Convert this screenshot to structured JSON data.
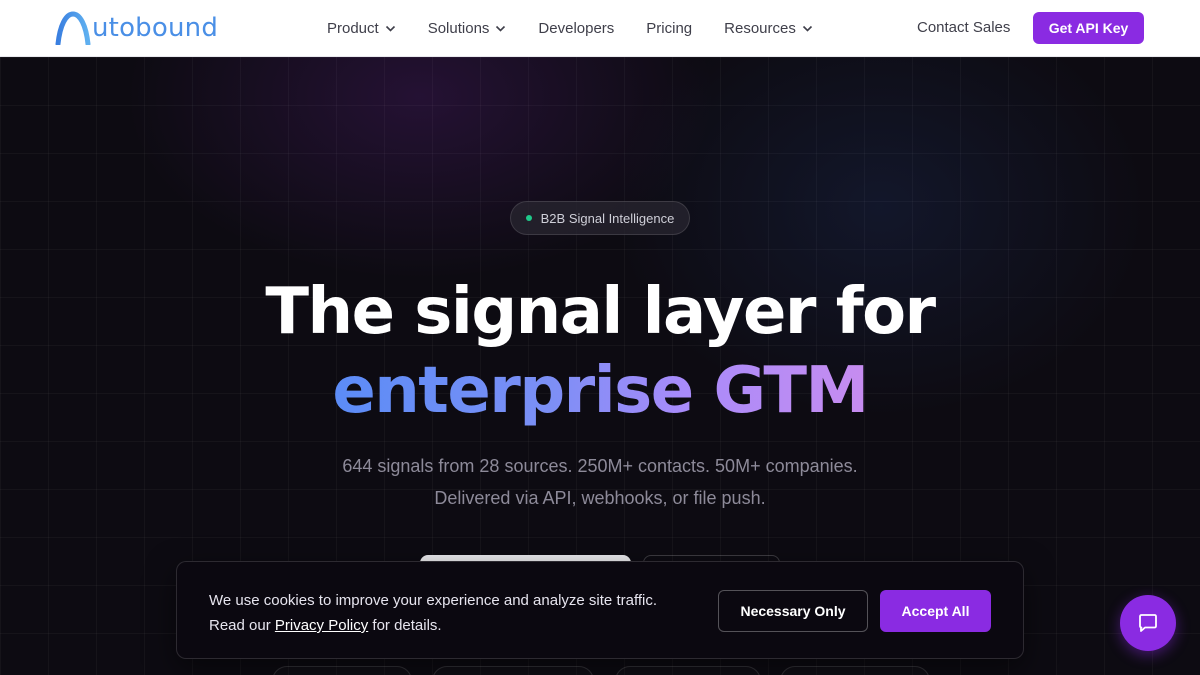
{
  "nav": {
    "logo_text": "utobound",
    "items": [
      {
        "label": "Product",
        "has_dropdown": true
      },
      {
        "label": "Solutions",
        "has_dropdown": true
      },
      {
        "label": "Developers",
        "has_dropdown": false
      },
      {
        "label": "Pricing",
        "has_dropdown": false
      },
      {
        "label": "Resources",
        "has_dropdown": true
      }
    ],
    "contact_label": "Contact Sales",
    "cta_label": "Get API Key"
  },
  "hero": {
    "badge": "B2B Signal Intelligence",
    "headline_line1": "The signal layer for",
    "headline_line2": "enterprise GTM",
    "subtitle_line1": "644 signals from 28 sources. 250M+ contacts. 50M+ companies.",
    "subtitle_line2": "Delivered via API, webhooks, or file push."
  },
  "cookie": {
    "line1": "We use cookies to improve your experience and analyze site traffic.",
    "line2_prefix": "Read our ",
    "link_label": "Privacy Policy",
    "line2_suffix": " for details.",
    "necessary_label": "Necessary Only",
    "accept_label": "Accept All"
  },
  "chat": {
    "icon": "chat-bubble-icon"
  },
  "colors": {
    "accent": "#8a2be2",
    "logo": "#4a8fe6",
    "badge_dot": "#1fc98a",
    "gradient_start": "#5b8cf7",
    "gradient_end": "#c78cf0",
    "hero_bg": "#0d0b12"
  }
}
